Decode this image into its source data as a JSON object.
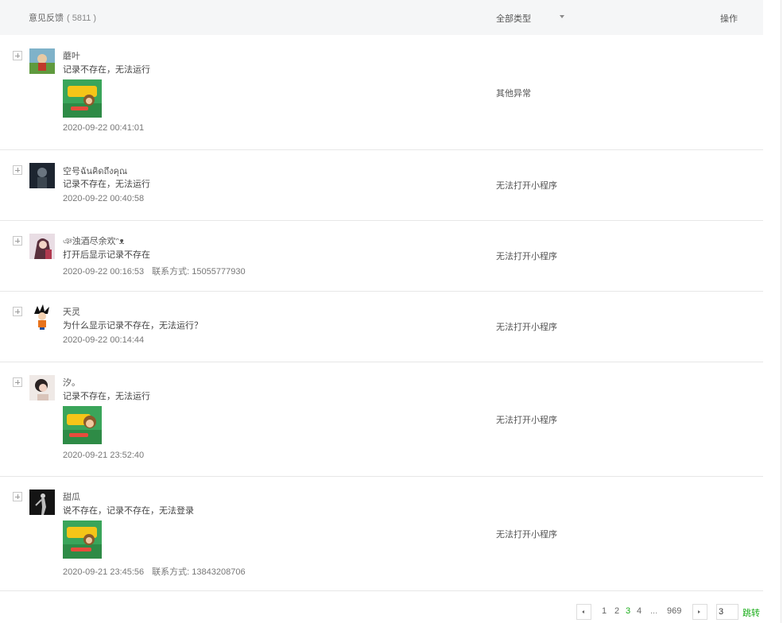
{
  "header": {
    "title": "意见反馈",
    "count": "( 5811 )",
    "type_filter": "全部类型",
    "ops": "操作"
  },
  "rows": [
    {
      "nickname": "蘑叶",
      "content": "记录不存在，无法运行",
      "time": "2020-09-22 00:41:01",
      "contact": "",
      "type": "其他异常",
      "has_image": true
    },
    {
      "nickname": "空号ฉันคิดถึงคุณ",
      "content": "记录不存在，无法运行",
      "time": "2020-09-22 00:40:58",
      "contact": "",
      "type": "无法打开小程序",
      "has_image": false
    },
    {
      "nickname": "ঞ浊酒尽余欢ᵔᴥ",
      "content": "打开后显示记录不存在",
      "time": "2020-09-22 00:16:53",
      "contact": "联系方式: 15055777930",
      "type": "无法打开小程序",
      "has_image": false
    },
    {
      "nickname": "天灵",
      "content": "为什么显示记录不存在，无法运行？",
      "time": "2020-09-22 00:14:44",
      "contact": "",
      "type": "无法打开小程序",
      "has_image": false
    },
    {
      "nickname": "汐。",
      "content": "记录不存在，无法运行",
      "time": "2020-09-21 23:52:40",
      "contact": "",
      "type": "无法打开小程序",
      "has_image": true
    },
    {
      "nickname": "甜瓜",
      "content": "说不存在，记录不存在，无法登录",
      "time": "2020-09-21 23:45:56",
      "contact": "联系方式: 13843208706",
      "type": "无法打开小程序",
      "has_image": true
    }
  ],
  "pagination": {
    "pages": [
      "1",
      "2",
      "3",
      "4"
    ],
    "current": "3",
    "ellipsis": "...",
    "last": "969",
    "input_value": "3",
    "go_label": "跳转"
  },
  "colors": {
    "accent": "#1aad19",
    "header_bg": "#f5f6f7",
    "divider": "#e7e7e7"
  },
  "icons": {
    "expand": "plus-square-icon",
    "filter": "caret-down-icon",
    "prev": "chevron-left-icon",
    "next": "chevron-right-icon"
  }
}
